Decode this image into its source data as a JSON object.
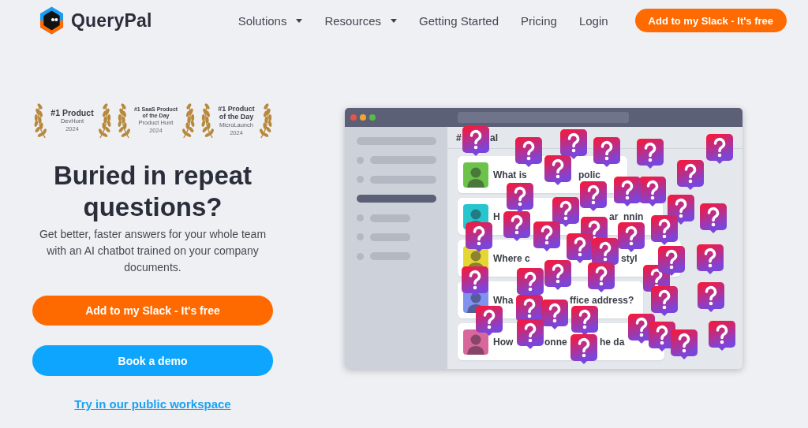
{
  "header": {
    "brand": "QueryPal",
    "nav": [
      {
        "label": "Solutions",
        "dropdown": true
      },
      {
        "label": "Resources",
        "dropdown": true
      },
      {
        "label": "Getting Started",
        "dropdown": false
      },
      {
        "label": "Pricing",
        "dropdown": false
      },
      {
        "label": "Login",
        "dropdown": false
      }
    ],
    "cta": "Add to my Slack - It's free"
  },
  "awards": [
    {
      "title": "#1 Product",
      "source": "DevHunt",
      "year": "2024"
    },
    {
      "title": "#1 SaaS Product of the Day",
      "source": "Product Hunt",
      "year": "2024"
    },
    {
      "title": "#1 Product of the Day",
      "source": "MicroLaunch",
      "year": "2024"
    }
  ],
  "hero": {
    "heading": "Buried in repeat questions?",
    "subtitle": "Get better, faster answers for your whole team with an AI chatbot trained on your company documents.",
    "buttons": [
      {
        "label": "Add to my Slack - It's free",
        "kind": "primary"
      },
      {
        "label": "Book a demo",
        "kind": "secondary"
      }
    ],
    "link": "Try in our public workspace"
  },
  "mock_window": {
    "sidebar_items": [
      {
        "kind": "heading",
        "selected": false
      },
      {
        "kind": "channel",
        "selected": false
      },
      {
        "kind": "channel",
        "selected": false
      },
      {
        "kind": "channel",
        "selected": true
      },
      {
        "kind": "channel",
        "selected": false
      },
      {
        "kind": "channel",
        "selected": false
      },
      {
        "kind": "channel",
        "selected": false
      }
    ],
    "channel_fragments": [
      "#",
      "al"
    ],
    "messages": [
      {
        "color": "#6cc24a",
        "fragments": [
          "What is",
          "polic"
        ]
      },
      {
        "color": "#27c6cf",
        "fragments": [
          "H",
          "ar",
          "nnin"
        ]
      },
      {
        "color": "#e5d634",
        "fragments": [
          "Where c",
          "styl"
        ]
      },
      {
        "color": "#8091ee",
        "fragments": [
          "Wha",
          "ffice address?"
        ]
      },
      {
        "color": "#d9679b",
        "fragments": [
          "How",
          "onne",
          "he da"
        ]
      }
    ]
  }
}
